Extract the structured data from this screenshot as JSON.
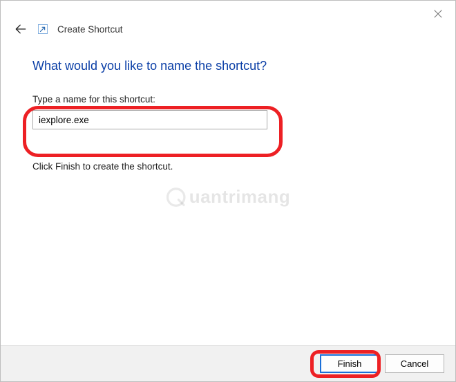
{
  "header": {
    "title": "Create Shortcut"
  },
  "content": {
    "question": "What would you like to name the shortcut?",
    "field_label": "Type a name for this shortcut:",
    "input_value": "iexplore.exe",
    "instruction": "Click Finish to create the shortcut."
  },
  "footer": {
    "finish": "Finish",
    "cancel": "Cancel"
  },
  "watermark": "uantrimang"
}
